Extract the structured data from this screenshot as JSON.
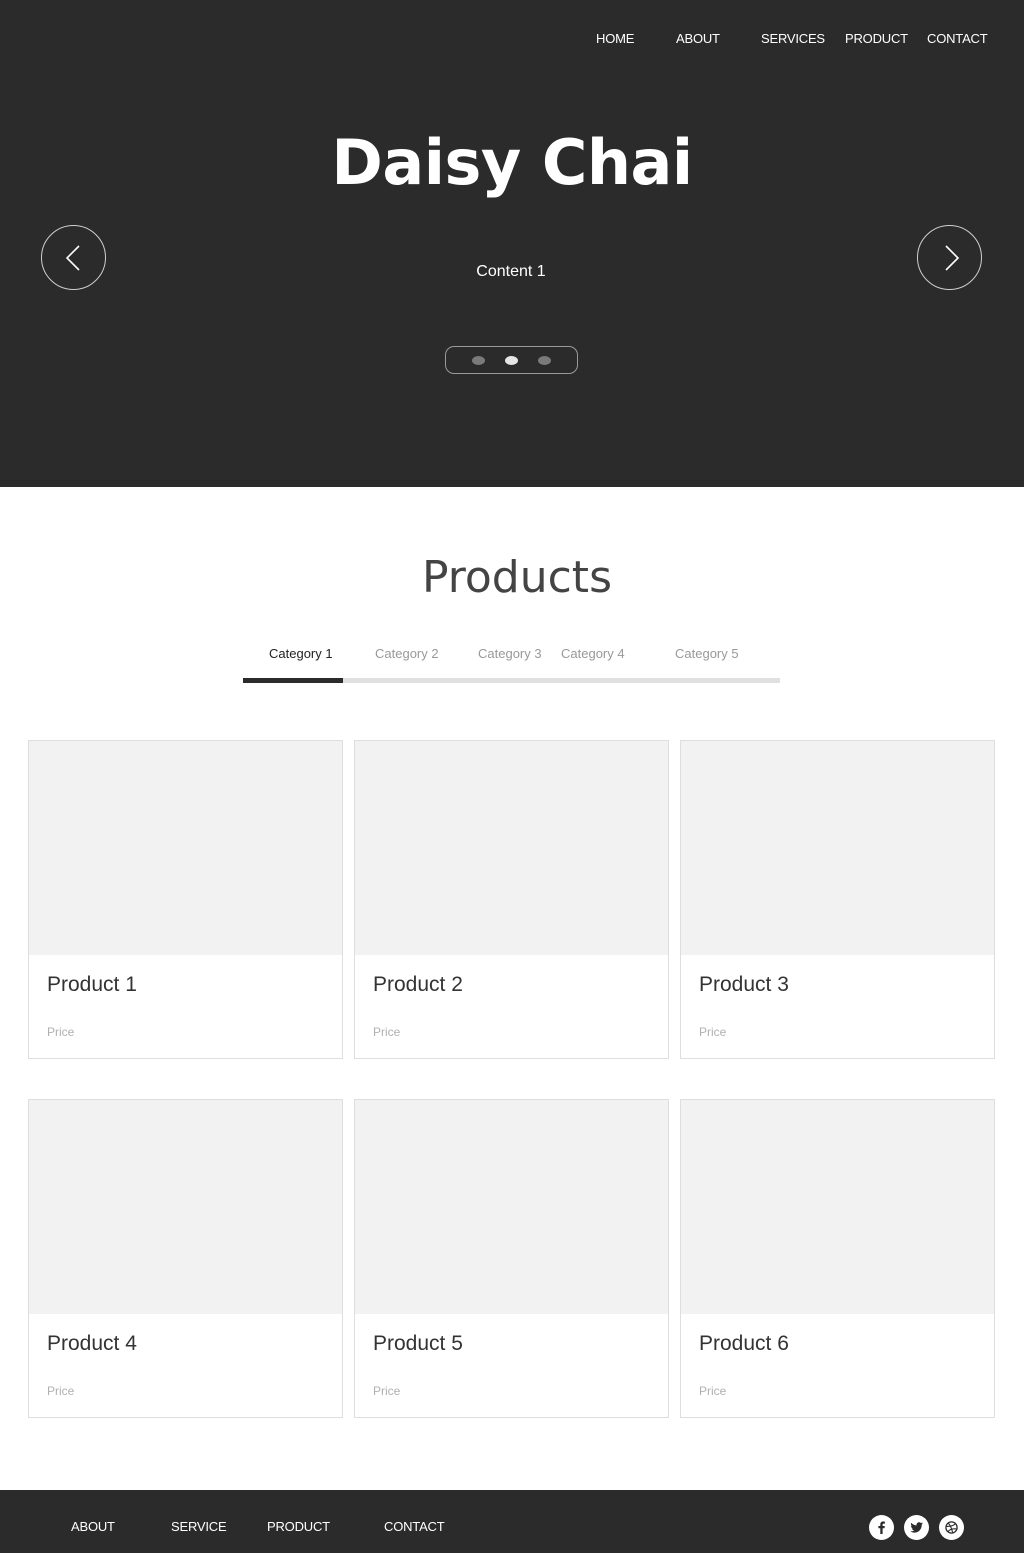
{
  "header": {
    "nav": [
      "HOME",
      "ABOUT",
      "SERVICES",
      "PRODUCT",
      "CONTACT"
    ]
  },
  "hero": {
    "title": "Daisy Chai",
    "subtitle": "Content 1",
    "arrows": {
      "prev_icon": "chevron-left-icon",
      "next_icon": "chevron-right-icon"
    },
    "slides": {
      "count": 3,
      "active": 2
    }
  },
  "products": {
    "title": "Products",
    "tabs": [
      "Category 1",
      "Category 2",
      "Category 3",
      "Category 4",
      "Category 5"
    ],
    "active_tab": 1,
    "items": [
      {
        "name": "Product 1",
        "price": "Price"
      },
      {
        "name": "Product 2",
        "price": "Price"
      },
      {
        "name": "Product 3",
        "price": "Price"
      },
      {
        "name": "Product 4",
        "price": "Price"
      },
      {
        "name": "Product 5",
        "price": "Price"
      },
      {
        "name": "Product 6",
        "price": "Price"
      }
    ]
  },
  "footer": {
    "links": [
      "ABOUT",
      "SERVICE",
      "PRODUCT",
      "CONTACT"
    ],
    "social": [
      "facebook-icon",
      "twitter-icon",
      "dribbble-icon"
    ]
  },
  "colors": {
    "dark": "#2b2b2b",
    "placeholder": "#f2f2f2",
    "tab_track": "#e0e0e0"
  }
}
